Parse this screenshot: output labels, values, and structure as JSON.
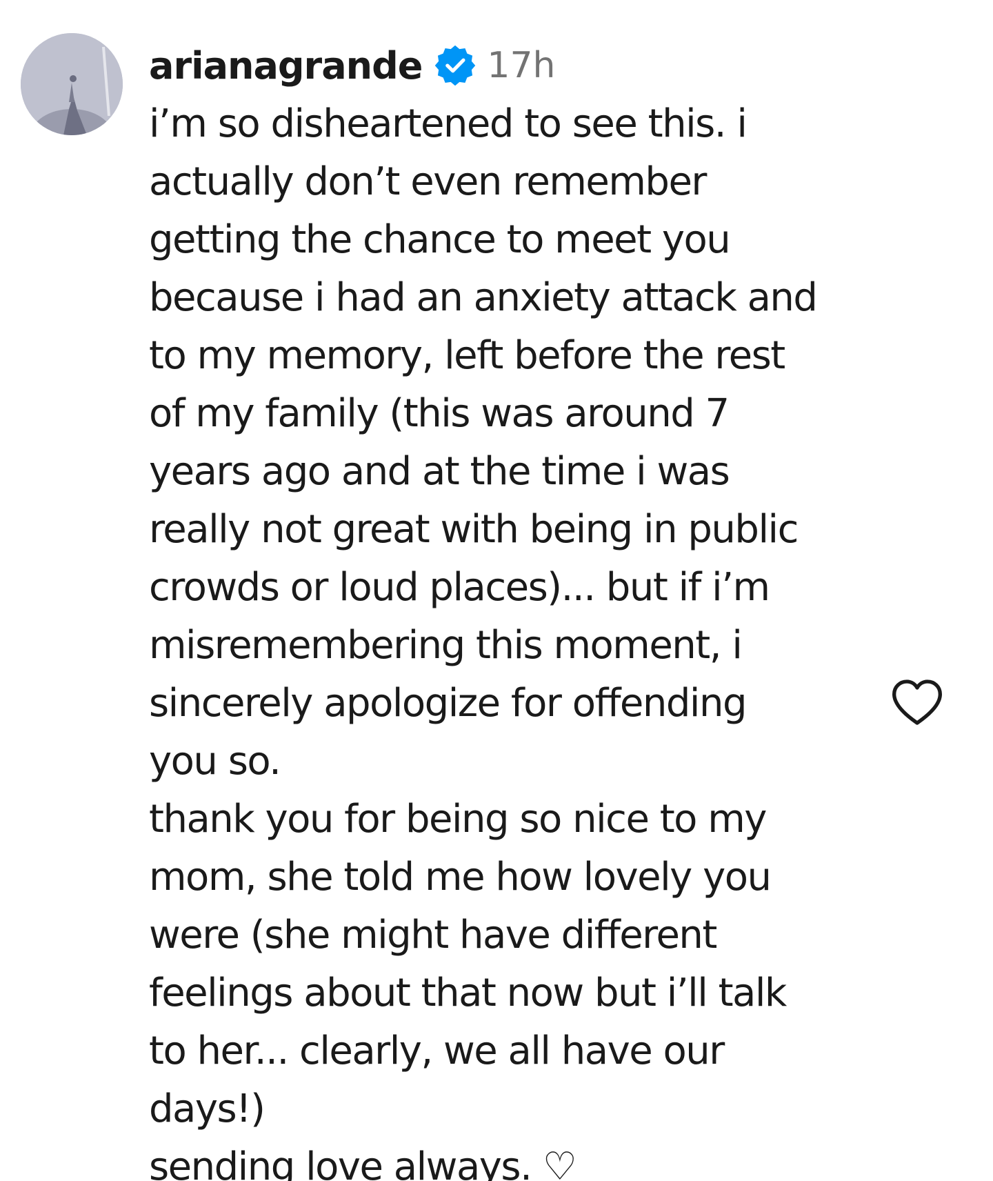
{
  "comment": {
    "username": "arianagrande",
    "verified_icon": "verified-badge-icon",
    "timestamp": "17h",
    "text_lines": [
      "i’m so disheartened to see this. i",
      "actually don’t even remember",
      "getting the chance to meet you",
      "because i had an anxiety attack and",
      "to my memory, left before the rest",
      "of my family (this was around 7",
      "years ago and at the time i was",
      "really not great with being in public",
      "crowds or loud places)... but if i’m",
      "misremembering this moment, i",
      "sincerely apologize for offending",
      "you so.",
      "thank you for being so nice to my",
      "mom, she told me how lovely you",
      "were (she might have different",
      "feelings about that now but i’ll talk",
      "to her... clearly, we all have our",
      "days!)",
      "sending love always. ♡"
    ],
    "like_icon": "heart-outline-icon"
  },
  "colors": {
    "text": "#1a1a1a",
    "timestamp": "#737373",
    "verified": "#0095f6"
  }
}
